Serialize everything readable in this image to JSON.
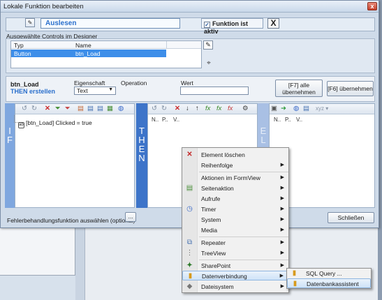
{
  "dialog": {
    "title": "Lokale Funktion bearbeiten",
    "close_glyph": "x"
  },
  "function": {
    "icon": "edit-function-icon",
    "name": "Auslesen",
    "active_label": "Funktion ist aktiv",
    "active_checked": true,
    "delete_glyph": "X"
  },
  "selected_controls": {
    "label": "Ausgewählte Controls im Designer",
    "columns": [
      "Typ",
      "Name"
    ],
    "rows": [
      {
        "typ": "Button",
        "name": "btn_Load"
      }
    ]
  },
  "control": {
    "name": "btn_Load",
    "then_label": "THEN erstellen",
    "eigenschaft_label": "Eigenschaft",
    "operation_label": "Operation",
    "wert_label": "Wert",
    "property_value": "Text",
    "wert_value": "",
    "f7_label_line1": "[F7] alle",
    "f7_label_line2": "übernehmen",
    "f6_label": "[F6] übernehmen"
  },
  "panes": {
    "if_letters": [
      "I",
      "F"
    ],
    "then_letters": [
      "T",
      "H",
      "E",
      "N"
    ],
    "else_letters": [
      "E",
      "L"
    ],
    "if_node": "[btn_Load] Clicked = true",
    "then_columns": [
      "N..",
      "P..",
      "V.."
    ],
    "else_columns": [
      "N..",
      "P..",
      "V.."
    ],
    "else_toolbar_text": "xyz"
  },
  "footer": {
    "error_label": "Fehlerbehandlungsfunktion auswählen (optional)",
    "error_button": "...",
    "close_button": "Schließen"
  },
  "context_menu": {
    "items": [
      {
        "label": "Element löschen",
        "icon": "delete-x-icon",
        "submenu": false
      },
      {
        "label": "Reihenfolge",
        "icon": "",
        "submenu": true
      },
      {
        "label": "Aktionen im FormView",
        "icon": "",
        "submenu": true
      },
      {
        "label": "Seitenaktion",
        "icon": "page-icon",
        "submenu": true
      },
      {
        "label": "Aufrufe",
        "icon": "",
        "submenu": true
      },
      {
        "label": "Timer",
        "icon": "clock-icon",
        "submenu": true
      },
      {
        "label": "System",
        "icon": "",
        "submenu": true
      },
      {
        "label": "Media",
        "icon": "",
        "submenu": true
      },
      {
        "label": "Repeater",
        "icon": "repeater-icon",
        "submenu": true
      },
      {
        "label": "TreeView",
        "icon": "treeview-icon",
        "submenu": true
      },
      {
        "label": "SharePoint",
        "icon": "sharepoint-icon",
        "submenu": true
      },
      {
        "label": "Datenverbindung",
        "icon": "database-icon",
        "submenu": true,
        "highlighted": true
      },
      {
        "label": "Dateisystem",
        "icon": "filesystem-icon",
        "submenu": true
      }
    ]
  },
  "sub_menu": {
    "items": [
      {
        "label": "SQL Query ...",
        "icon": "database-icon"
      },
      {
        "label": "Datenbankassistent",
        "icon": "database-icon",
        "highlighted": true
      }
    ]
  },
  "colors": {
    "accent_blue": "#3d8ee9",
    "then_blue": "#3d74c9",
    "if_blue": "#7fa7df",
    "menu_bg": "#f1f1f1"
  }
}
